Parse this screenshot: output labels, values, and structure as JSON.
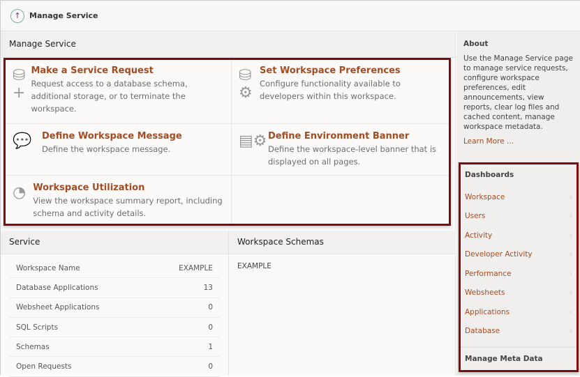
{
  "topbar": {
    "title": "Manage Service"
  },
  "main": {
    "title": "Manage Service",
    "cards": [
      {
        "title": "Make a Service Request",
        "desc": "Request access to a database schema, additional storage, or to terminate the workspace.",
        "icon": "database-plus-icon"
      },
      {
        "title": "Set Workspace Preferences",
        "desc": "Configure functionality available to developers within this workspace.",
        "icon": "database-gear-icon"
      },
      {
        "title": "Define Workspace Message",
        "desc": "Define the workspace message.",
        "icon": "message-pencil-icon"
      },
      {
        "title": "Define Environment Banner",
        "desc": "Define the workspace-level banner that is displayed on all pages.",
        "icon": "window-gear-icon"
      },
      {
        "title": "Workspace Utilization",
        "desc": "View the workspace summary report, including schema and activity details.",
        "icon": "gauge-icon"
      }
    ]
  },
  "service": {
    "title": "Service",
    "rows": [
      {
        "label": "Workspace Name",
        "value": "EXAMPLE"
      },
      {
        "label": "Database Applications",
        "value": "13"
      },
      {
        "label": "Websheet Applications",
        "value": "0"
      },
      {
        "label": "SQL Scripts",
        "value": "0"
      },
      {
        "label": "Schemas",
        "value": "1"
      },
      {
        "label": "Open Requests",
        "value": "0"
      }
    ]
  },
  "schemas": {
    "title": "Workspace Schemas",
    "values": [
      "EXAMPLE"
    ]
  },
  "sidebar": {
    "about_title": "About",
    "about_text": "Use the Manage Service page to manage service requests, configure workspace preferences, edit announcements, view reports, clear log files and cached content, manage workspace metadata.",
    "learn_more": "Learn More ...",
    "dashboards_title": "Dashboards",
    "dashboards": [
      "Workspace",
      "Users",
      "Activity",
      "Developer Activity",
      "Performance",
      "Websheets",
      "Applications",
      "Database"
    ],
    "meta": "Manage Meta Data"
  }
}
